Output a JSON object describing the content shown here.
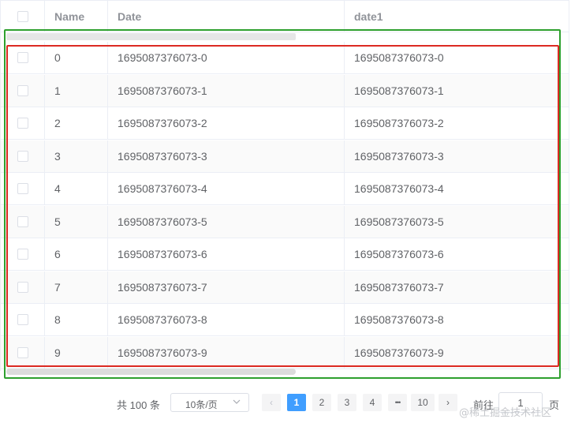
{
  "table": {
    "columns": {
      "name": "Name",
      "date": "Date",
      "date1": "date1"
    },
    "rows": [
      {
        "name": "0",
        "date": "1695087376073-0",
        "date1": "1695087376073-0"
      },
      {
        "name": "1",
        "date": "1695087376073-1",
        "date1": "1695087376073-1"
      },
      {
        "name": "2",
        "date": "1695087376073-2",
        "date1": "1695087376073-2"
      },
      {
        "name": "3",
        "date": "1695087376073-3",
        "date1": "1695087376073-3"
      },
      {
        "name": "4",
        "date": "1695087376073-4",
        "date1": "1695087376073-4"
      },
      {
        "name": "5",
        "date": "1695087376073-5",
        "date1": "1695087376073-5"
      },
      {
        "name": "6",
        "date": "1695087376073-6",
        "date1": "1695087376073-6"
      },
      {
        "name": "7",
        "date": "1695087376073-7",
        "date1": "1695087376073-7"
      },
      {
        "name": "8",
        "date": "1695087376073-8",
        "date1": "1695087376073-8"
      },
      {
        "name": "9",
        "date": "1695087376073-9",
        "date1": "1695087376073-9"
      }
    ]
  },
  "pagination": {
    "total_text": "共 100 条",
    "page_size": "10条/页",
    "prev_icon": "‹",
    "next_icon": "›",
    "pages": [
      "1",
      "2",
      "3",
      "4"
    ],
    "ellipsis": "•••",
    "last_page": "10",
    "current_page": "1",
    "goto_label": "前往",
    "goto_value": "1",
    "page_unit": "页"
  },
  "watermark": "@稀土掘金技术社区",
  "colors": {
    "accent": "#409eff",
    "outer_highlight": "#2ea02e",
    "inner_highlight": "#dc2a22"
  }
}
